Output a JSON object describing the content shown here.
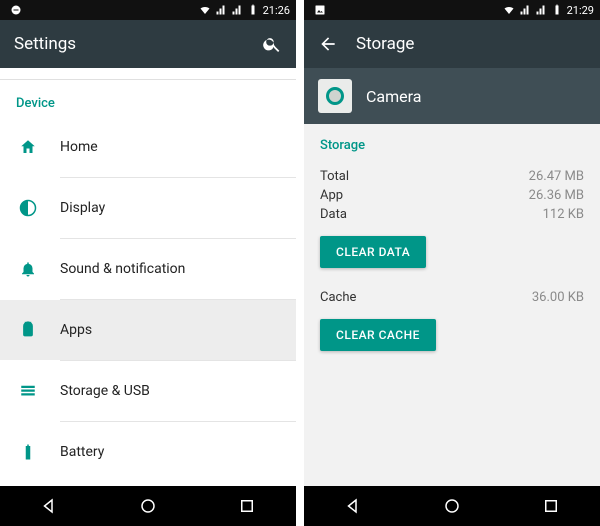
{
  "left": {
    "statusbar": {
      "time": "21:26"
    },
    "appbar": {
      "title": "Settings"
    },
    "section": "Device",
    "items": [
      {
        "icon": "home-icon",
        "label": "Home",
        "selected": false
      },
      {
        "icon": "display-icon",
        "label": "Display",
        "selected": false
      },
      {
        "icon": "bell-icon",
        "label": "Sound & notification",
        "selected": false
      },
      {
        "icon": "android-icon",
        "label": "Apps",
        "selected": true
      },
      {
        "icon": "storage-icon",
        "label": "Storage & USB",
        "selected": false
      },
      {
        "icon": "battery-icon",
        "label": "Battery",
        "selected": false
      }
    ]
  },
  "right": {
    "statusbar": {
      "time": "21:29"
    },
    "appbar": {
      "title": "Storage"
    },
    "app": {
      "name": "Camera"
    },
    "storage": {
      "heading": "Storage",
      "total_label": "Total",
      "total_value": "26.47 MB",
      "app_label": "App",
      "app_value": "26.36 MB",
      "data_label": "Data",
      "data_value": "112 KB",
      "clear_data_label": "CLEAR DATA",
      "cache_label": "Cache",
      "cache_value": "36.00 KB",
      "clear_cache_label": "CLEAR CACHE"
    }
  }
}
